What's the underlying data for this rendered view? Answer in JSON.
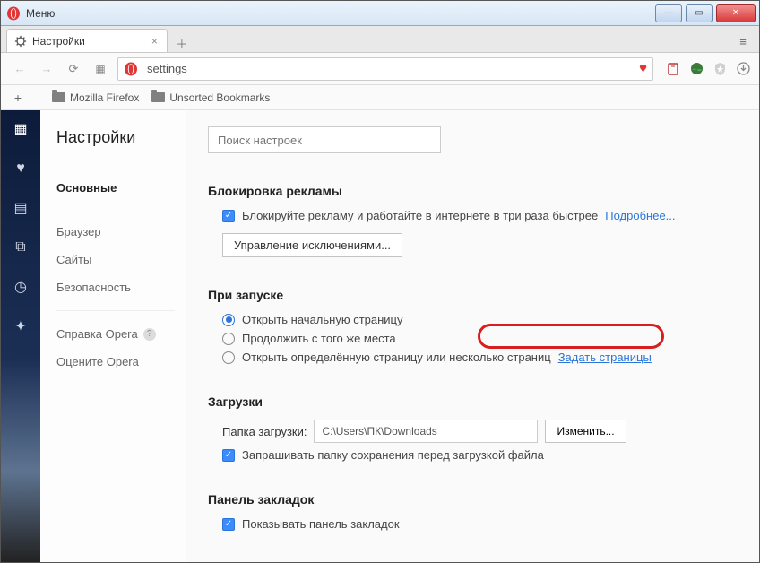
{
  "window": {
    "menu_label": "Меню"
  },
  "tab": {
    "title": "Настройки"
  },
  "toolbar": {
    "url": "settings"
  },
  "bookmarks": {
    "folder1": "Mozilla Firefox",
    "folder2": "Unsorted Bookmarks"
  },
  "nav": {
    "title": "Настройки",
    "items": {
      "basic": "Основные",
      "browser": "Браузер",
      "sites": "Сайты",
      "security": "Безопасность",
      "help": "Справка Opera",
      "rate": "Оцените Opera"
    }
  },
  "main": {
    "search_placeholder": "Поиск настроек",
    "sections": {
      "adblock": {
        "title": "Блокировка рекламы",
        "check_label": "Блокируйте рекламу и работайте в интернете в три раза быстрее",
        "more": "Подробнее...",
        "exceptions_btn": "Управление исключениями..."
      },
      "startup": {
        "title": "При запуске",
        "opt1": "Открыть начальную страницу",
        "opt2": "Продолжить с того же места",
        "opt3": "Открыть определённую страницу или несколько страниц",
        "set_pages": "Задать страницы"
      },
      "downloads": {
        "title": "Загрузки",
        "folder_label": "Папка загрузки:",
        "folder_value": "C:\\Users\\ПК\\Downloads",
        "change_btn": "Изменить...",
        "ask_label": "Запрашивать папку сохранения перед загрузкой файла"
      },
      "bookbar": {
        "title": "Панель закладок",
        "show_label": "Показывать панель закладок"
      }
    }
  }
}
